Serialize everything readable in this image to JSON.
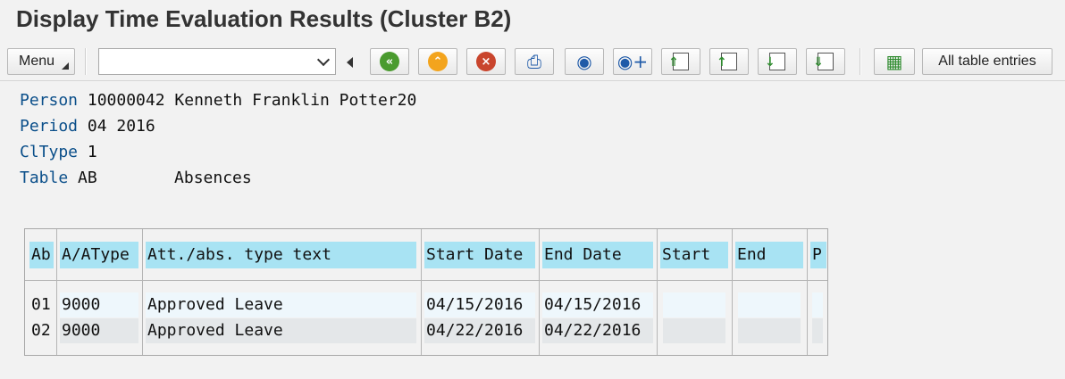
{
  "title": "Display Time Evaluation Results (Cluster B2)",
  "toolbar": {
    "menu_label": "Menu",
    "command_value": "",
    "all_entries_label": "All table entries",
    "icons": [
      "back-icon",
      "exit-icon",
      "cancel-icon",
      "print-icon",
      "find-icon",
      "find-next-icon",
      "first-page-icon",
      "previous-page-icon",
      "next-page-icon",
      "last-page-icon",
      "display-icon"
    ]
  },
  "info": {
    "person_label": "Person",
    "person_value": "10000042 Kenneth Franklin Potter20",
    "period_label": "Period",
    "period_value": "04 2016",
    "cltype_label": "ClType",
    "cltype_value": "1",
    "table_label": "Table",
    "table_code": "AB",
    "table_name": "Absences"
  },
  "table": {
    "headers": [
      "Ab",
      "A/AType",
      "Att./abs. type text",
      "Start Date",
      "End Date",
      "Start",
      "End",
      "P"
    ],
    "rows": [
      [
        "01",
        "9000",
        "Approved Leave",
        "04/15/2016",
        "04/15/2016",
        "",
        "",
        ""
      ],
      [
        "02",
        "9000",
        "Approved Leave",
        "04/22/2016",
        "04/22/2016",
        "",
        "",
        ""
      ]
    ]
  },
  "colors": {
    "header_bg": "#a8e3f3",
    "label_blue": "#0b4f8a",
    "back_green": "#4a9b2f",
    "exit_orange": "#f3a41d",
    "cancel_red": "#c9452d"
  }
}
